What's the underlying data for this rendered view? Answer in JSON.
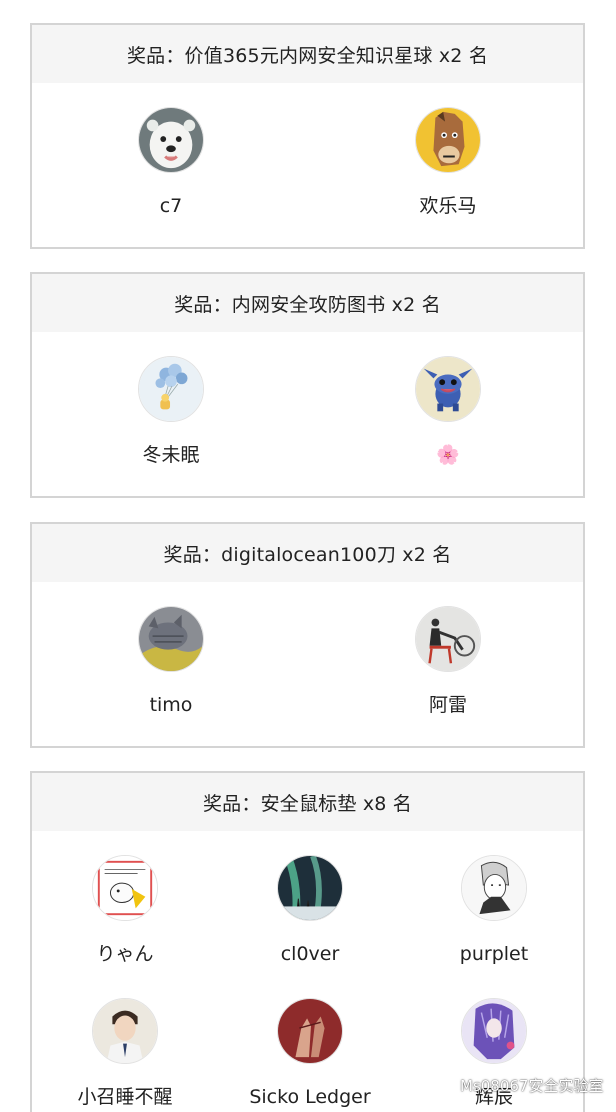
{
  "prizes": [
    {
      "title": "奖品：价值365元内网安全知识星球 x2 名",
      "winners": [
        {
          "name": "c7",
          "avatar": "white-dog-avatar"
        },
        {
          "name": "欢乐马",
          "avatar": "cartoon-horse-avatar"
        }
      ]
    },
    {
      "title": "奖品：内网安全攻防图书 x2 名",
      "winners": [
        {
          "name": "冬未眠",
          "avatar": "balloons-avatar"
        },
        {
          "name": "🌸",
          "avatar": "stitch-avatar"
        }
      ]
    },
    {
      "title": "奖品：digitalocean100刀 x2 名",
      "winners": [
        {
          "name": "timo",
          "avatar": "cat-avatar"
        },
        {
          "name": "阿雷",
          "avatar": "person-chair-avatar"
        }
      ]
    },
    {
      "title": "奖品：安全鼠标垫 x8 名",
      "winners": [
        {
          "name": "りゃん",
          "avatar": "sticker-avatar"
        },
        {
          "name": "cl0ver",
          "avatar": "aurora-avatar"
        },
        {
          "name": "purplet",
          "avatar": "anime-sketch-avatar"
        },
        {
          "name": "小召睡不醒",
          "avatar": "young-man-avatar"
        },
        {
          "name": "Sicko Ledger",
          "avatar": "red-hands-avatar"
        },
        {
          "name": "辉辰",
          "avatar": "anime-purple-avatar"
        }
      ]
    }
  ],
  "watermark": "Ms08067安全实验室",
  "colors": {
    "border": "#d4d4d4",
    "header_bg": "#f5f5f5",
    "text": "#222222"
  }
}
